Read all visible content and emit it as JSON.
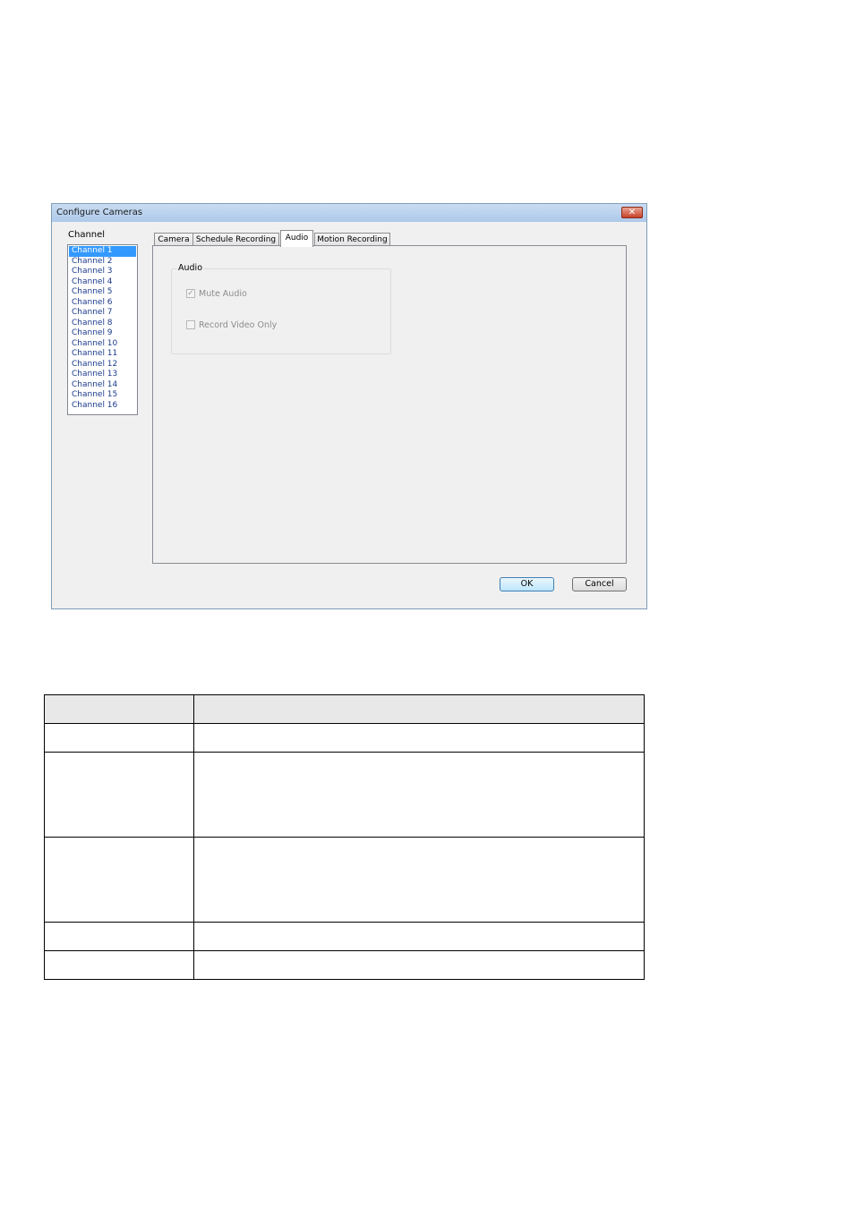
{
  "dialog": {
    "title": "Configure Cameras",
    "close_glyph": "✕",
    "channel_label": "Channel",
    "channels": [
      "Channel 1",
      "Channel 2",
      "Channel 3",
      "Channel 4",
      "Channel 5",
      "Channel 6",
      "Channel 7",
      "Channel 8",
      "Channel 9",
      "Channel 10",
      "Channel 11",
      "Channel 12",
      "Channel 13",
      "Channel 14",
      "Channel 15",
      "Channel 16"
    ],
    "selected_channel": "Channel 1",
    "tabs": [
      "Camera",
      "Schedule Recording",
      "Audio",
      "Motion Recording"
    ],
    "active_tab": "Audio",
    "audio_group": {
      "title": "Audio",
      "mute_audio": {
        "label": "Mute Audio",
        "checked": true,
        "enabled": false
      },
      "record_video_only": {
        "label": "Record Video Only",
        "checked": false,
        "enabled": false
      }
    },
    "ok_label": "OK",
    "cancel_label": "Cancel"
  },
  "colors": {
    "title_bar": "#aec9ea",
    "selection": "#3399ff",
    "close_button": "#c7432a"
  }
}
